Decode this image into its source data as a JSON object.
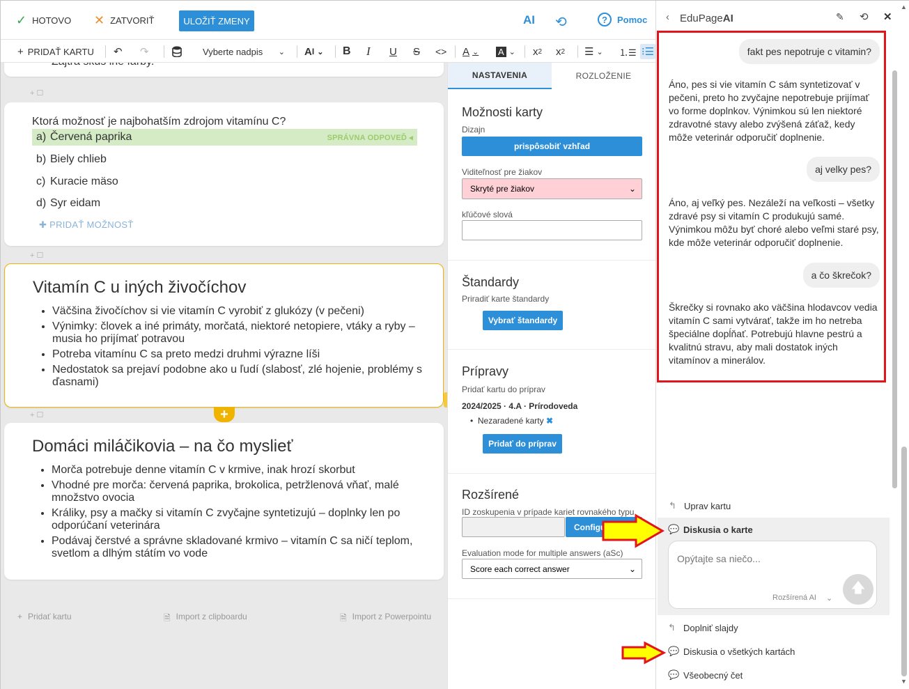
{
  "topbar": {
    "done_label": "HOTOVO",
    "close_label": "ZATVORIŤ",
    "save_label": "ULOŽIŤ ZMENY",
    "ai_label": "AI",
    "help_label": "Pomoc"
  },
  "toolbar": {
    "add_card_label": "PRIDAŤ KARTU",
    "heading_select": "Vyberte nadpis"
  },
  "cards": {
    "prev_fragment": "Zajtra skús iné farby.",
    "question": {
      "title": "Ktorá možnosť je najbohatším zdrojom vitamínu C?",
      "correct_tag": "SPRÁVNA ODPOVEĎ",
      "options": [
        {
          "letter": "a)",
          "text": "Červená paprika"
        },
        {
          "letter": "b)",
          "text": "Biely chlieb"
        },
        {
          "letter": "c)",
          "text": "Kuracie mäso"
        },
        {
          "letter": "d)",
          "text": "Syr eidam"
        }
      ],
      "add_option": "PRIDAŤ MOŽNOSŤ"
    },
    "card2": {
      "title": "Vitamín C u iných živočíchov",
      "bullets": [
        "Väčšina živočíchov si vie vitamín C vyrobiť z glukózy (v pečeni)",
        "Výnimky: človek a iné primáty, morčatá, niektoré netopiere, vtáky a ryby – musia ho prijímať potravou",
        "Potreba vitamínu C sa preto medzi druhmi výrazne líši",
        "Nedostatok sa prejaví podobne ako u ľudí (slabosť, zlé hojenie, problémy s ďasnami)"
      ]
    },
    "card3": {
      "title": "Domáci miláčikovia – na čo myslieť",
      "bullets": [
        "Morča potrebuje denne vitamín C v krmive, inak hrozí skorbut",
        "Vhodné pre morča: červená paprika, brokolica, petržlenová vňať, malé množstvo ovocia",
        "Králiky, psy a mačky si vitamín C zvyčajne syntetizujú – doplnky len po odporúčaní veterinára",
        "Podávaj čerstvé a správne skladované krmivo – vitamín C sa ničí teplom, svetlom a dlhým státím vo vode"
      ]
    },
    "footer": {
      "add_card": "Pridať kartu",
      "import_clipboard": "Import z clipboardu",
      "import_ppt": "Import z Powerpointu"
    }
  },
  "settings": {
    "tab_settings": "NASTAVENIA",
    "tab_layout": "ROZLOŽENIE",
    "card_options": {
      "title": "Možnosti karty",
      "design_label": "Dizajn",
      "design_button": "prispôsobiť vzhľad",
      "visibility_label": "Viditeľnosť pre žiakov",
      "visibility_value": "Skryté pre žiakov",
      "keywords_label": "kľúčové slová"
    },
    "standards": {
      "title": "Štandardy",
      "desc": "Priradiť karte štandardy",
      "button": "Vybrať štandardy"
    },
    "preparations": {
      "title": "Prípravy",
      "desc": "Pridať kartu do príprav",
      "course": "2024/2025 · 4.A · Prírodoveda",
      "item": "Nezaradené karty",
      "button": "Pridať do príprav"
    },
    "advanced": {
      "title": "Rozšírené",
      "group_label": "ID zoskupenia v prípade kariet rovnakého typu",
      "config_button": "Configu",
      "eval_label": "Evaluation mode for multiple answers (aSc)",
      "eval_value": "Score each correct answer"
    }
  },
  "ai_panel": {
    "title_prefix": "EduPage",
    "title_suffix": "AI",
    "messages": [
      {
        "role": "user",
        "text": "fakt pes nepotruje c vitamin?"
      },
      {
        "role": "ai",
        "text": "Áno, pes si vie vitamín C sám syntetizovať v pečeni, preto ho zvyčajne nepotrebuje prijímať vo forme doplnkov. Výnimkou sú len niektoré zdravotné stavy alebo zvýšená záťaž, kedy môže veterinár odporučiť doplnenie."
      },
      {
        "role": "user",
        "text": "aj velky pes?"
      },
      {
        "role": "ai",
        "text": "Áno, aj veľký pes. Nezáleží na veľkosti – všetky zdravé psy si vitamín C produkujú samé. Výnimkou môžu byť choré alebo veľmi staré psy, kde môže veterinár odporučiť doplnenie."
      },
      {
        "role": "user",
        "text": "a čo škrečok?"
      },
      {
        "role": "ai",
        "text": "Škrečky si rovnako ako väčšina hlodavcov vedia vitamín C sami vytvárať, takže im ho netreba špeciálne dopĺňať. Potrebujú hlavne pestrú a kvalitnú stravu, aby mali dostatok iných vitamínov a minerálov."
      }
    ],
    "menu": {
      "edit_card": "Uprav kartu",
      "discuss_card": "Diskusia o karte",
      "input_placeholder": "Opýtajte sa niečo...",
      "mode": "Rozšírená AI",
      "fill_slides": "Doplniť slajdy",
      "discuss_all": "Diskusia o všetkých kartách",
      "general_chat": "Všeobecný čet"
    }
  },
  "colors": {
    "accent": "#2d8fd8",
    "selected_card": "#f0b400",
    "correct_bg": "#d4ebc5",
    "highlight_box": "#e2151b",
    "arrow_fill": "#ffff00"
  }
}
